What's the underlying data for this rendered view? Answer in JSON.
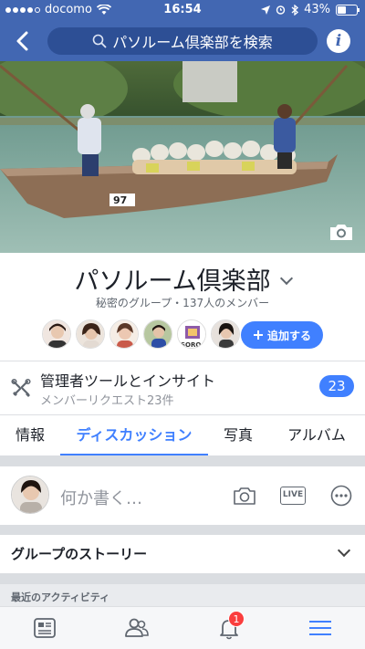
{
  "status_bar": {
    "carrier": "docomo",
    "time": "16:54",
    "battery": "43%"
  },
  "nav": {
    "search_placeholder": "パソルーム倶楽部を検索"
  },
  "group": {
    "name": "パソルーム倶楽部",
    "subtitle": "秘密のグループ・137人のメンバー",
    "add_button": "追加する"
  },
  "admin": {
    "title": "管理者ツールとインサイト",
    "subtitle": "メンバーリクエスト23件",
    "badge": "23"
  },
  "tabs": [
    {
      "label": "情報"
    },
    {
      "label": "ディスカッション"
    },
    {
      "label": "写真"
    },
    {
      "label": "アルバム"
    }
  ],
  "composer": {
    "placeholder": "何か書く…",
    "live_label": "LIVE"
  },
  "stories": {
    "title": "グループのストーリー"
  },
  "activity": {
    "label": "最近のアクティビティ"
  },
  "bottom_nav": {
    "notification_count": "1"
  },
  "colors": {
    "brand": "#4267b2",
    "accent": "#4080ff",
    "badge": "#fa3e3e"
  }
}
